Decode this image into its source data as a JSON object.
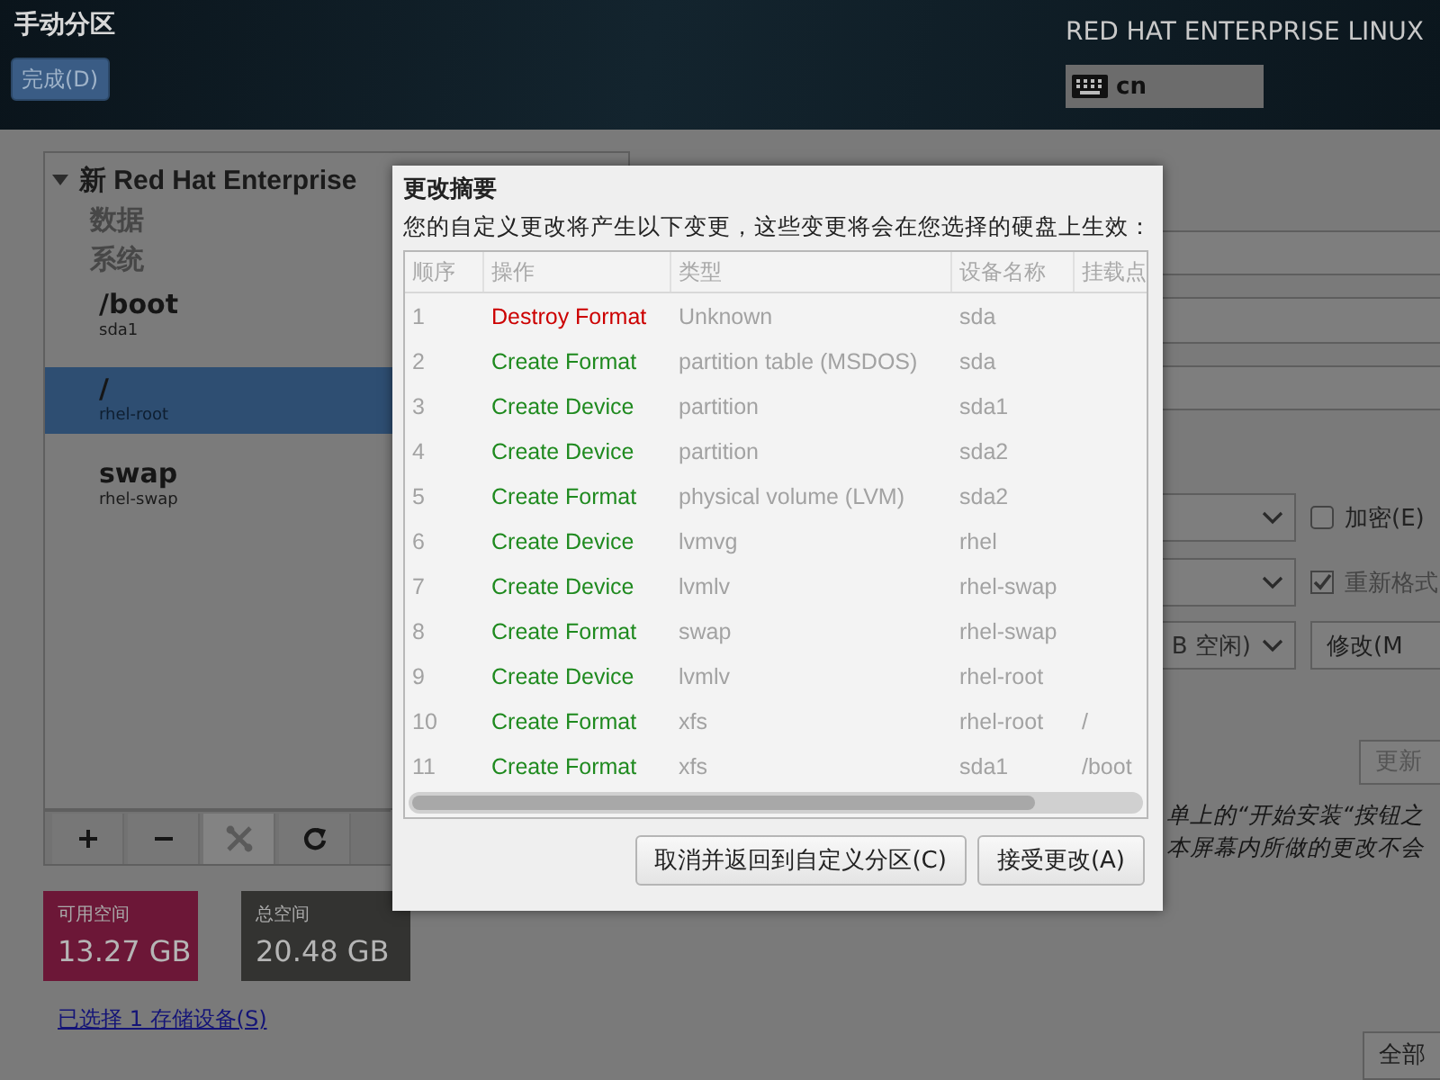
{
  "header": {
    "title": "手动分区",
    "done_button": "完成(D)",
    "product": "RED HAT ENTERPRISE LINUX",
    "keyboard_layout": "cn"
  },
  "partitions": {
    "install_title": "新 Red Hat Enterprise",
    "expanded": true,
    "sections": [
      {
        "label": "数据"
      },
      {
        "label": "系统",
        "items": [
          {
            "name": "/boot",
            "device": "sda1",
            "selected": false
          },
          {
            "name": "/",
            "device": "rhel-root",
            "selected": true
          },
          {
            "name": "swap",
            "device": "rhel-swap",
            "selected": false
          }
        ]
      }
    ]
  },
  "toolbar": [
    {
      "kind": "add",
      "disabled": false
    },
    {
      "kind": "remove",
      "disabled": false
    },
    {
      "kind": "configure",
      "disabled": true
    },
    {
      "kind": "refresh",
      "disabled": false
    }
  ],
  "space": [
    {
      "kind": "available",
      "label": "可用空间",
      "value": "13.27 GB"
    },
    {
      "kind": "total",
      "label": "总空间",
      "value": "20.48 GB"
    }
  ],
  "storage_link": "已选择 1 存储设备(S)",
  "details": {
    "encrypt": {
      "label": "加密(E)",
      "checked": false
    },
    "reformat": {
      "label": "重新格式",
      "checked": true
    },
    "size_policy": "B 空闲)",
    "modify_button": "修改(M",
    "update_button": "更新",
    "note_lines": [
      "单上的“开始安装“按钮之",
      "本屏幕内所做的更改不会"
    ],
    "reset_button": "全部"
  },
  "dialog": {
    "title": "更改摘要",
    "message": "您的自定义更改将产生以下变更，这些变更将会在您选择的硬盘上生效：",
    "columns": [
      "顺序",
      "操作",
      "类型",
      "设备名称",
      "挂载点"
    ],
    "rows": [
      {
        "order": "1",
        "action": "Destroy Format",
        "kind": "destroy",
        "type": "Unknown",
        "device": "sda"
      },
      {
        "order": "2",
        "action": "Create Format",
        "kind": "create",
        "type": "partition table (MSDOS)",
        "device": "sda"
      },
      {
        "order": "3",
        "action": "Create Device",
        "kind": "create",
        "type": "partition",
        "device": "sda1"
      },
      {
        "order": "4",
        "action": "Create Device",
        "kind": "create",
        "type": "partition",
        "device": "sda2"
      },
      {
        "order": "5",
        "action": "Create Format",
        "kind": "create",
        "type": "physical volume (LVM)",
        "device": "sda2"
      },
      {
        "order": "6",
        "action": "Create Device",
        "kind": "create",
        "type": "lvmvg",
        "device": "rhel"
      },
      {
        "order": "7",
        "action": "Create Device",
        "kind": "create",
        "type": "lvmlv",
        "device": "rhel-swap"
      },
      {
        "order": "8",
        "action": "Create Format",
        "kind": "create",
        "type": "swap",
        "device": "rhel-swap"
      },
      {
        "order": "9",
        "action": "Create Device",
        "kind": "create",
        "type": "lvmlv",
        "device": "rhel-root"
      },
      {
        "order": "10",
        "action": "Create Format",
        "kind": "create",
        "type": "xfs",
        "device": "rhel-root",
        "mount": "/"
      },
      {
        "order": "11",
        "action": "Create Format",
        "kind": "create",
        "type": "xfs",
        "device": "sda1",
        "mount": "/boot"
      }
    ],
    "buttons": [
      "取消并返回到自定义分区(C)",
      "接受更改(A)"
    ]
  }
}
